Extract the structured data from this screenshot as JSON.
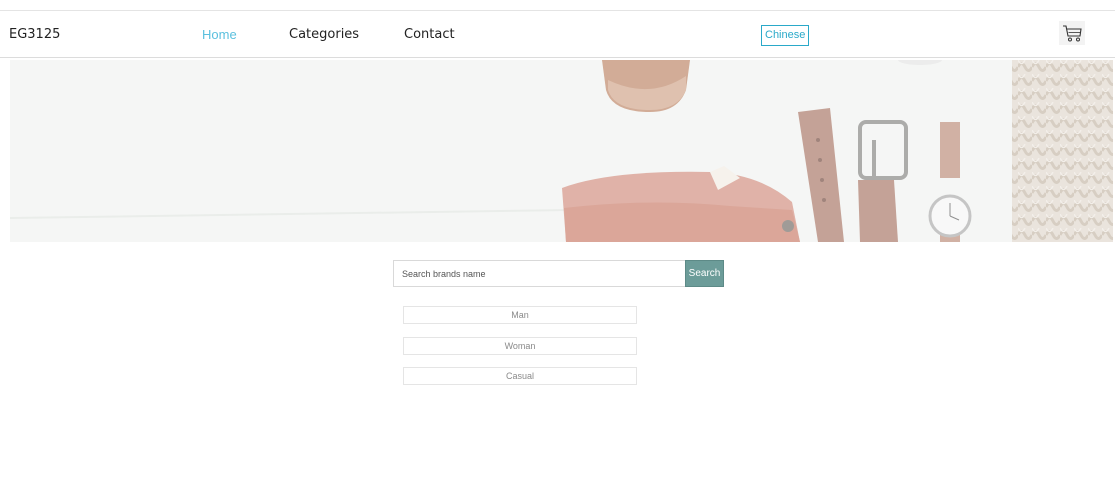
{
  "header": {
    "brand": "EG3125",
    "nav": [
      {
        "label": "Home",
        "active": true
      },
      {
        "label": "Categories",
        "active": false
      },
      {
        "label": "Contact",
        "active": false
      }
    ],
    "language_button": "Chinese",
    "cart_icon": "cart-icon"
  },
  "hero": {
    "image": "fashion-accessories-banner"
  },
  "search": {
    "placeholder": "Search brands name",
    "value": "",
    "button": "Search"
  },
  "categories": [
    "Man",
    "Woman",
    "Casual"
  ],
  "colors": {
    "accent": "#5bc0de",
    "language_border": "#2aa9c9",
    "search_button": "#6c9c99"
  }
}
